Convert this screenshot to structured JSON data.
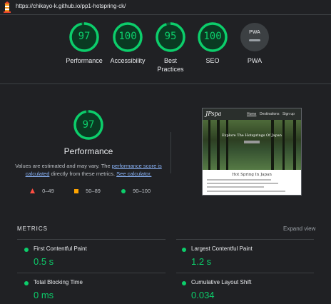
{
  "address_bar": {
    "url": "https://chikayo-k.github.io/pp1-hotspring-ck/"
  },
  "colors": {
    "pass": "#0cce6b",
    "average": "#ffa400",
    "fail": "#ff4e42",
    "background": "#202124",
    "link": "#8ab4f8"
  },
  "summary_gauges": [
    {
      "score": "97",
      "label_line1": "Performance",
      "label_line2": ""
    },
    {
      "score": "100",
      "label_line1": "Accessibility",
      "label_line2": ""
    },
    {
      "score": "95",
      "label_line1": "Best",
      "label_line2": "Practices"
    },
    {
      "score": "100",
      "label_line1": "SEO",
      "label_line2": ""
    },
    {
      "score": "PWA",
      "label_line1": "PWA",
      "label_line2": ""
    }
  ],
  "performance": {
    "score": "97",
    "score_fraction": 0.97,
    "title": "Performance",
    "desc_part1": "Values are estimated and may vary. The ",
    "desc_link1": "performance score is calculated",
    "desc_part2": " directly from these metrics. ",
    "desc_link2": "See calculator."
  },
  "legend": {
    "fail": "0–49",
    "average": "50–89",
    "pass": "90–100"
  },
  "screenshot_preview": {
    "brand": "JPspa",
    "nav": [
      "Home",
      "Destinations",
      "Sign up"
    ],
    "hero_text": "Explore The Hotsprings Of Japan",
    "heading": "Hot Spring In Japan"
  },
  "metrics": {
    "header": "METRICS",
    "expand_label": "Expand view",
    "items": [
      {
        "title": "First Contentful Paint",
        "value": "0.5 s"
      },
      {
        "title": "Largest Contentful Paint",
        "value": "1.2 s"
      },
      {
        "title": "Total Blocking Time",
        "value": "0 ms"
      },
      {
        "title": "Cumulative Layout Shift",
        "value": "0.034"
      }
    ]
  }
}
